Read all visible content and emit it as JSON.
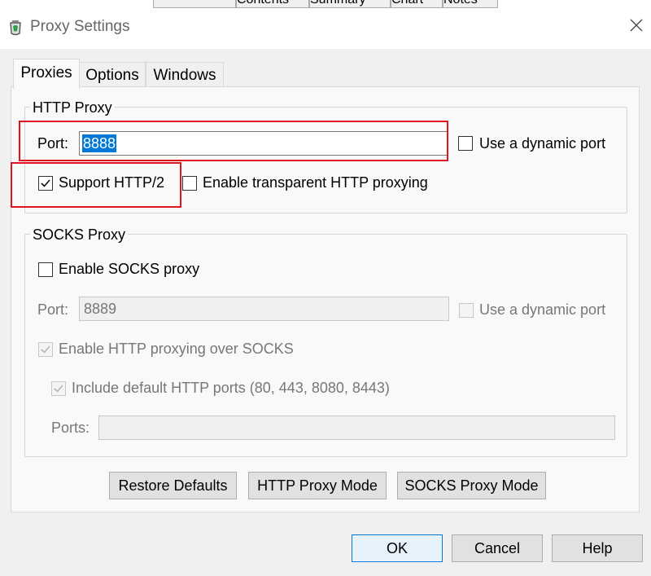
{
  "background_tabs": [
    "Contents",
    "Summary",
    "Chart",
    "Notes"
  ],
  "window": {
    "title": "Proxy Settings"
  },
  "tabs": [
    {
      "label": "Proxies",
      "active": true
    },
    {
      "label": "Options",
      "active": false
    },
    {
      "label": "Windows",
      "active": false
    }
  ],
  "http_proxy": {
    "legend": "HTTP Proxy",
    "port_label": "Port:",
    "port_value": "8888",
    "dynamic_port_label": "Use a dynamic port",
    "dynamic_port_checked": false,
    "http2_label": "Support HTTP/2",
    "http2_checked": true,
    "transparent_label": "Enable transparent HTTP proxying",
    "transparent_checked": false
  },
  "socks_proxy": {
    "legend": "SOCKS Proxy",
    "enable_label": "Enable SOCKS proxy",
    "enable_checked": false,
    "port_label": "Port:",
    "port_value": "8889",
    "dynamic_port_label": "Use a dynamic port",
    "http_over_socks_label": "Enable HTTP proxying over SOCKS",
    "include_ports_label": "Include default HTTP ports (80, 443, 8080, 8443)",
    "ports_label": "Ports:",
    "ports_value": ""
  },
  "buttons": {
    "restore": "Restore Defaults",
    "http_mode": "HTTP Proxy Mode",
    "socks_mode": "SOCKS Proxy Mode",
    "ok": "OK",
    "cancel": "Cancel",
    "help": "Help"
  },
  "colors": {
    "highlight": "#e0141e",
    "selection": "#0078d7"
  },
  "icons": {
    "app": "fiddler-app-icon",
    "close": "close-icon",
    "check": "checkmark-icon"
  }
}
